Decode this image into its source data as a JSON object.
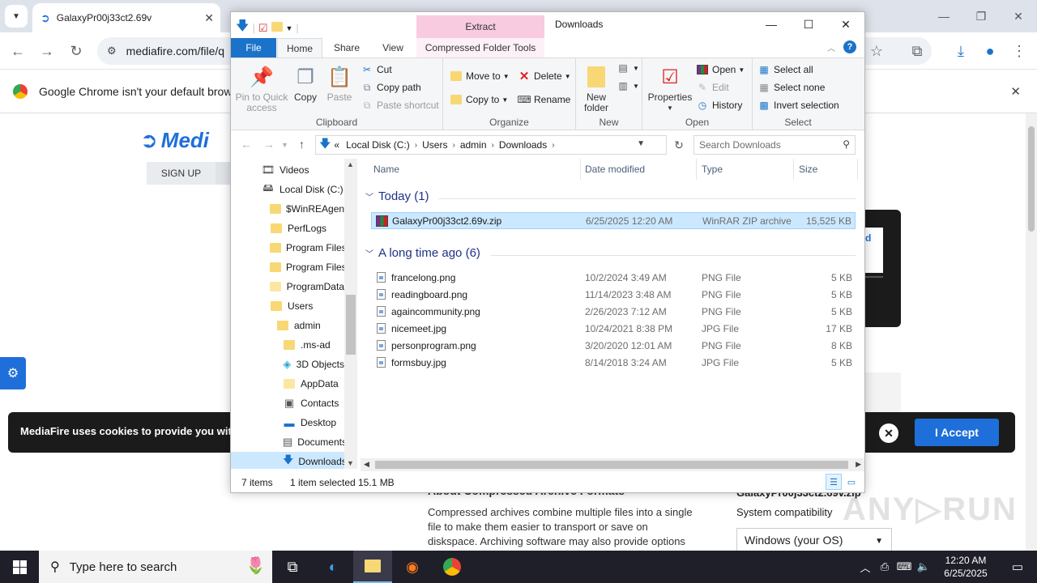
{
  "browser": {
    "tab_title": "GalaxyPr00j33ct2.69v",
    "url": "mediafire.com/file/q",
    "infobar_message": "Google Chrome isn't your default browse"
  },
  "webpage": {
    "logo_text": "Medi",
    "signup_label": "SIGN UP",
    "side_card_text": "d",
    "cookie_text": "MediaFire uses cookies to provide you with a",
    "cookie_close": "✕",
    "cookie_accept": "I Accept",
    "article_heading": "About Compressed Archive Formats",
    "article_body": "Compressed archives combine multiple files into a single file to make them easier to transport or save on diskspace. Archiving software may also provide options",
    "side_filename": "GalaxyPr00j33ct2.69v.zip",
    "side_compat": "System compatibility",
    "side_os": "Windows (your OS)",
    "watermark": "ANY▷RUN"
  },
  "explorer": {
    "title": "Downloads",
    "contextual_group": "Extract",
    "ribbon_tabs": {
      "file": "File",
      "home": "Home",
      "share": "Share",
      "view": "View",
      "compressed": "Compressed Folder Tools"
    },
    "clipboard": {
      "pin": "Pin to Quick access",
      "copy": "Copy",
      "paste": "Paste",
      "cut": "Cut",
      "copy_path": "Copy path",
      "paste_shortcut": "Paste shortcut",
      "label": "Clipboard"
    },
    "organize": {
      "move_to": "Move to",
      "copy_to": "Copy to",
      "delete": "Delete",
      "rename": "Rename",
      "label": "Organize"
    },
    "new": {
      "new_folder": "New folder",
      "label": "New"
    },
    "open": {
      "properties": "Properties",
      "open": "Open",
      "edit": "Edit",
      "history": "History",
      "label": "Open"
    },
    "select": {
      "select_all": "Select all",
      "select_none": "Select none",
      "invert": "Invert selection",
      "label": "Select"
    },
    "address": {
      "prefix": "«",
      "crumbs": [
        "Local Disk (C:)",
        "Users",
        "admin",
        "Downloads"
      ],
      "search_placeholder": "Search Downloads"
    },
    "nav_items": [
      {
        "label": "Videos",
        "icon": "videos-icon"
      },
      {
        "label": "Local Disk (C:)",
        "icon": "drive-icon"
      },
      {
        "label": "$WinREAgent",
        "icon": "folder-icon"
      },
      {
        "label": "PerfLogs",
        "icon": "folder-icon"
      },
      {
        "label": "Program Files",
        "icon": "folder-icon"
      },
      {
        "label": "Program Files",
        "icon": "folder-icon"
      },
      {
        "label": "ProgramData",
        "icon": "folder-icon"
      },
      {
        "label": "Users",
        "icon": "folder-icon"
      },
      {
        "label": "admin",
        "icon": "folder-icon"
      },
      {
        "label": ".ms-ad",
        "icon": "folder-icon"
      },
      {
        "label": "3D Objects",
        "icon": "3d-objects-icon"
      },
      {
        "label": "AppData",
        "icon": "folder-icon"
      },
      {
        "label": "Contacts",
        "icon": "contacts-icon"
      },
      {
        "label": "Desktop",
        "icon": "desktop-icon"
      },
      {
        "label": "Documents",
        "icon": "documents-icon"
      },
      {
        "label": "Downloads",
        "icon": "downloads-icon"
      }
    ],
    "columns": {
      "name": "Name",
      "date": "Date modified",
      "type": "Type",
      "size": "Size"
    },
    "groups": [
      {
        "title": "Today (1)",
        "files": [
          {
            "name": "GalaxyPr00j33ct2.69v.zip",
            "date": "6/25/2025 12:20 AM",
            "type": "WinRAR ZIP archive",
            "size": "15,525 KB"
          }
        ]
      },
      {
        "title": "A long time ago (6)",
        "files": [
          {
            "name": "francelong.png",
            "date": "10/2/2024 3:49 AM",
            "type": "PNG File",
            "size": "5 KB"
          },
          {
            "name": "readingboard.png",
            "date": "11/14/2023 3:48 AM",
            "type": "PNG File",
            "size": "5 KB"
          },
          {
            "name": "againcommunity.png",
            "date": "2/26/2023 7:12 AM",
            "type": "PNG File",
            "size": "5 KB"
          },
          {
            "name": "nicemeet.jpg",
            "date": "10/24/2021 8:38 PM",
            "type": "JPG File",
            "size": "17 KB"
          },
          {
            "name": "personprogram.png",
            "date": "3/20/2020 12:01 AM",
            "type": "PNG File",
            "size": "8 KB"
          },
          {
            "name": "formsbuy.jpg",
            "date": "8/14/2018 3:24 AM",
            "type": "JPG File",
            "size": "5 KB"
          }
        ]
      }
    ],
    "status": {
      "items": "7 items",
      "selected": "1 item selected",
      "size": "15.1 MB"
    }
  },
  "taskbar": {
    "search_placeholder": "Type here to search",
    "time": "12:20 AM",
    "date": "6/25/2025"
  },
  "colors": {
    "accent": "#1a73c8",
    "selection": "#cce8ff",
    "mediafire_blue": "#1e6fd9",
    "extract_tab": "#f8cbe0",
    "taskbar": "#1f1f2a"
  }
}
